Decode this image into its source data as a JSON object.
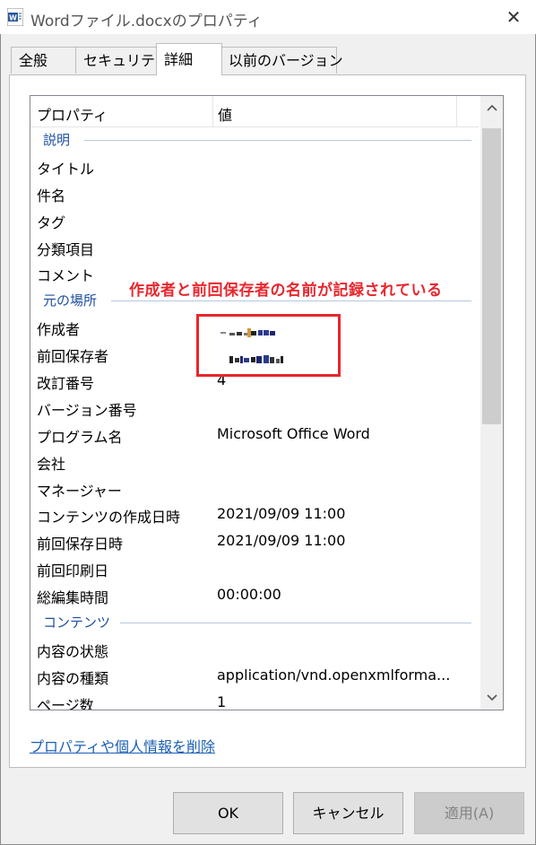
{
  "window": {
    "title": "Wordファイル.docxのプロパティ",
    "close_label": "✕"
  },
  "tabs": [
    {
      "label": "全般"
    },
    {
      "label": "セキュリティ"
    },
    {
      "label": "詳細"
    },
    {
      "label": "以前のバージョン"
    }
  ],
  "list": {
    "header": {
      "property": "プロパティ",
      "value": "値"
    },
    "groups": {
      "description": "説明",
      "origin": "元の場所",
      "content": "コンテンツ"
    },
    "rows": {
      "title": {
        "key": "タイトル",
        "value": ""
      },
      "subject": {
        "key": "件名",
        "value": ""
      },
      "tags": {
        "key": "タグ",
        "value": ""
      },
      "category": {
        "key": "分類項目",
        "value": ""
      },
      "comment": {
        "key": "コメント",
        "value": ""
      },
      "author": {
        "key": "作成者",
        "value": ""
      },
      "last_saved_by": {
        "key": "前回保存者",
        "value": ""
      },
      "revision": {
        "key": "改訂番号",
        "value": "4"
      },
      "version": {
        "key": "バージョン番号",
        "value": ""
      },
      "program": {
        "key": "プログラム名",
        "value": "Microsoft Office Word"
      },
      "company": {
        "key": "会社",
        "value": ""
      },
      "manager": {
        "key": "マネージャー",
        "value": ""
      },
      "content_created": {
        "key": "コンテンツの作成日時",
        "value": "2021/09/09 11:00"
      },
      "date_saved": {
        "key": "前回保存日時",
        "value": "2021/09/09 11:00"
      },
      "last_printed": {
        "key": "前回印刷日",
        "value": ""
      },
      "total_edit": {
        "key": "総編集時間",
        "value": "00:00:00"
      },
      "content_status": {
        "key": "内容の状態",
        "value": ""
      },
      "content_type": {
        "key": "内容の種類",
        "value": "application/vnd.openxmlforma..."
      },
      "pages": {
        "key": "ページ数",
        "value": "1"
      }
    }
  },
  "annotation": {
    "text": "作成者と前回保存者の名前が記録されている",
    "color": "#e8262d"
  },
  "remove_link": "プロパティや個人情報を削除",
  "buttons": {
    "ok": "OK",
    "cancel": "キャンセル",
    "apply": "適用(A)"
  },
  "icons": {
    "app": "word-icon",
    "close": "close-icon",
    "scroll_up": "chevron-up-icon",
    "scroll_down": "chevron-down-icon"
  }
}
